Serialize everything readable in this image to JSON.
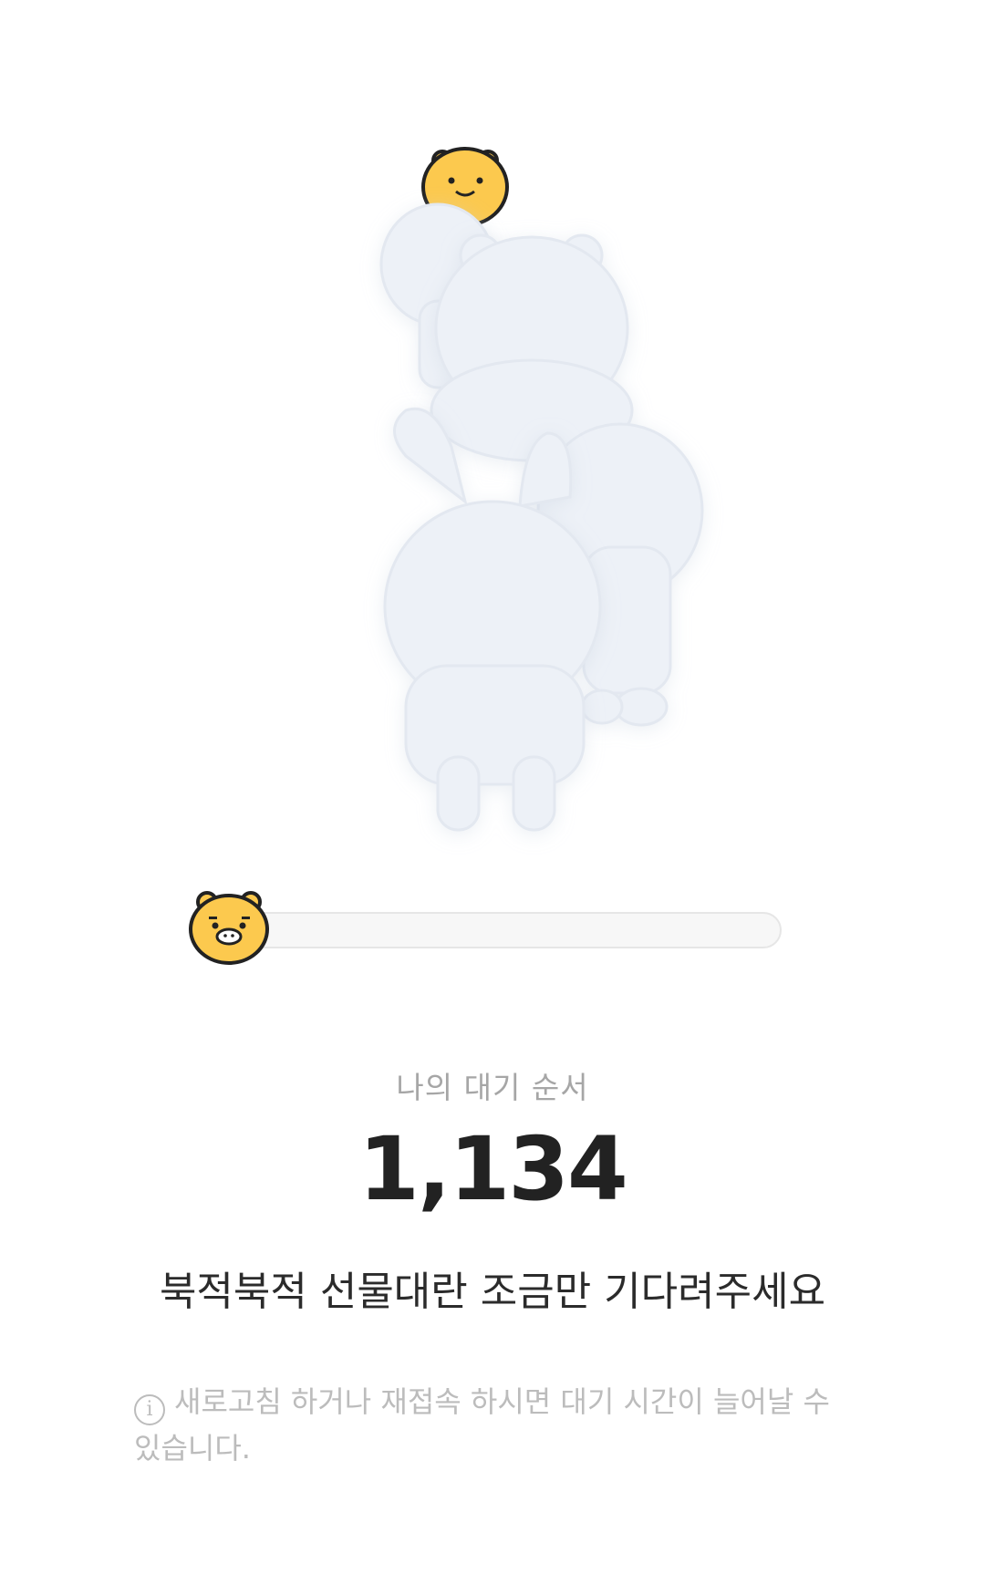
{
  "illustration": {
    "characters": [
      "ryan-icon",
      "ghost-bear-icon",
      "ghost-rabbit-icon",
      "ghost-lion-icon"
    ],
    "accent_color": "#fcc94e"
  },
  "progress": {
    "value": 0.0,
    "thumb_icon": "ryan-icon"
  },
  "queue": {
    "label": "나의 대기 순서",
    "number": "1,134"
  },
  "message": "북적북적 선물대란 조금만 기다려주세요",
  "notice": {
    "icon": "info-icon",
    "text": "새로고침 하거나 재접속 하시면 대기 시간이 늘어날 수 있습니다."
  }
}
